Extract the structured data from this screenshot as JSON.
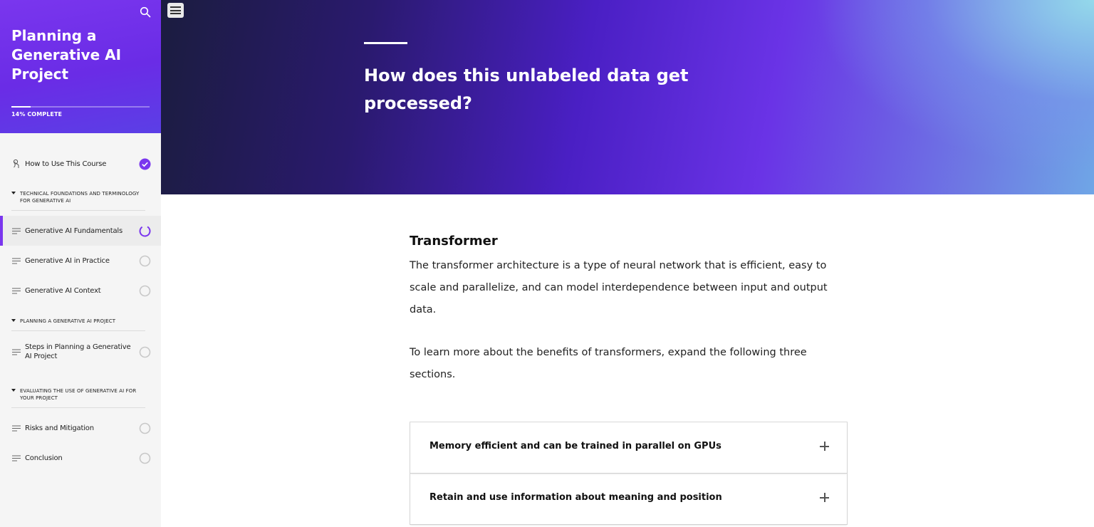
{
  "sidebar": {
    "course_title": "Planning a Generative AI Project",
    "progress_percent": 14,
    "progress_label": "14% COMPLETE",
    "items": [
      {
        "type": "lesson",
        "label": "How to Use This Course",
        "icon": "touch-icon",
        "status": "complete"
      },
      {
        "type": "section",
        "label": "TECHNICAL FOUNDATIONS AND TERMINOLOGY FOR GENERATIVE AI"
      },
      {
        "type": "lesson",
        "label": "Generative AI Fundamentals",
        "icon": "lines-icon",
        "status": "in-progress",
        "active": true
      },
      {
        "type": "lesson",
        "label": "Generative AI in Practice",
        "icon": "lines-icon",
        "status": "not-started"
      },
      {
        "type": "lesson",
        "label": "Generative AI Context",
        "icon": "lines-icon",
        "status": "not-started"
      },
      {
        "type": "section",
        "label": "PLANNING A GENERATIVE AI PROJECT"
      },
      {
        "type": "lesson",
        "label": "Steps in Planning a Generative AI Project",
        "icon": "lines-icon",
        "status": "not-started"
      },
      {
        "type": "section",
        "label": "EVALUATING THE USE OF GENERATIVE AI FOR YOUR PROJECT"
      },
      {
        "type": "lesson",
        "label": "Risks and Mitigation",
        "icon": "lines-icon",
        "status": "not-started"
      },
      {
        "type": "lesson",
        "label": "Conclusion",
        "icon": "lines-icon",
        "status": "not-started"
      }
    ]
  },
  "hero": {
    "title": "How does this unlabeled data get processed?"
  },
  "content": {
    "heading": "Transformer",
    "paragraphs": [
      "The transformer architecture is a type of neural network that is efficient, easy to scale and parallelize, and can model interdependence between input and output data.",
      "To learn more about the benefits of transformers, expand the following three sections."
    ],
    "accordion": [
      {
        "label": "Memory efficient and can be trained in parallel on GPUs"
      },
      {
        "label": "Retain and use information about meaning and position"
      }
    ]
  },
  "colors": {
    "accent": "#7a36ee",
    "status_complete": "#7a36ee",
    "status_pending": "#c8c8c8"
  }
}
